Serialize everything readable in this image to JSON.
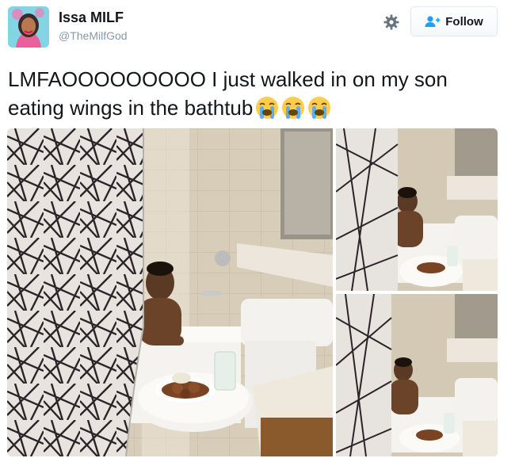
{
  "user": {
    "display_name": "Issa MILF",
    "handle": "@TheMilfGod",
    "avatar": "profile-avatar-cartoon"
  },
  "header": {
    "settings_icon": "gear-icon",
    "follow_label": "Follow",
    "follow_icon": "add-user-icon"
  },
  "tweet": {
    "text": "LMFAOOOOOOOOO I just walked in on my son eating wings in the bathtub",
    "emoji_count": 3,
    "emoji": "loudly-crying-face"
  },
  "media": {
    "photos": [
      "bathroom-photo-main",
      "bathroom-photo-top-right",
      "bathroom-photo-bottom-right"
    ]
  },
  "colors": {
    "text": "#14171a",
    "muted": "#8899a6",
    "border": "#e1e8ed",
    "follow_icon": "#1da1f2"
  }
}
